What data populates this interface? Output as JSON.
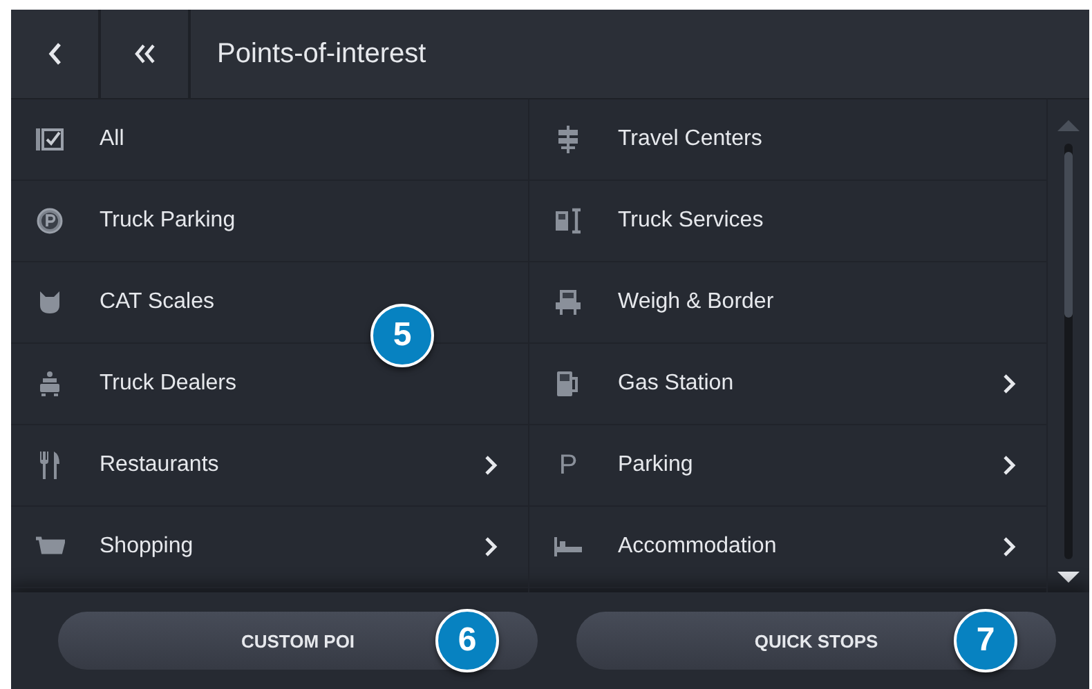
{
  "header": {
    "title": "Points-of-interest"
  },
  "columns": [
    [
      {
        "label": "All",
        "chevron": false
      },
      {
        "label": "Truck Parking",
        "chevron": false
      },
      {
        "label": "CAT Scales",
        "chevron": false
      },
      {
        "label": "Truck Dealers",
        "chevron": false
      },
      {
        "label": "Restaurants",
        "chevron": true
      },
      {
        "label": "Shopping",
        "chevron": true
      }
    ],
    [
      {
        "label": "Travel Centers",
        "chevron": false
      },
      {
        "label": "Truck Services",
        "chevron": false
      },
      {
        "label": "Weigh & Border",
        "chevron": false
      },
      {
        "label": "Gas Station",
        "chevron": true
      },
      {
        "label": "Parking",
        "icon_text": "P",
        "chevron": true
      },
      {
        "label": "Accommodation",
        "chevron": true
      }
    ]
  ],
  "buttons": [
    "CUSTOM POI",
    "QUICK STOPS"
  ],
  "callouts": [
    "5",
    "6",
    "7"
  ]
}
